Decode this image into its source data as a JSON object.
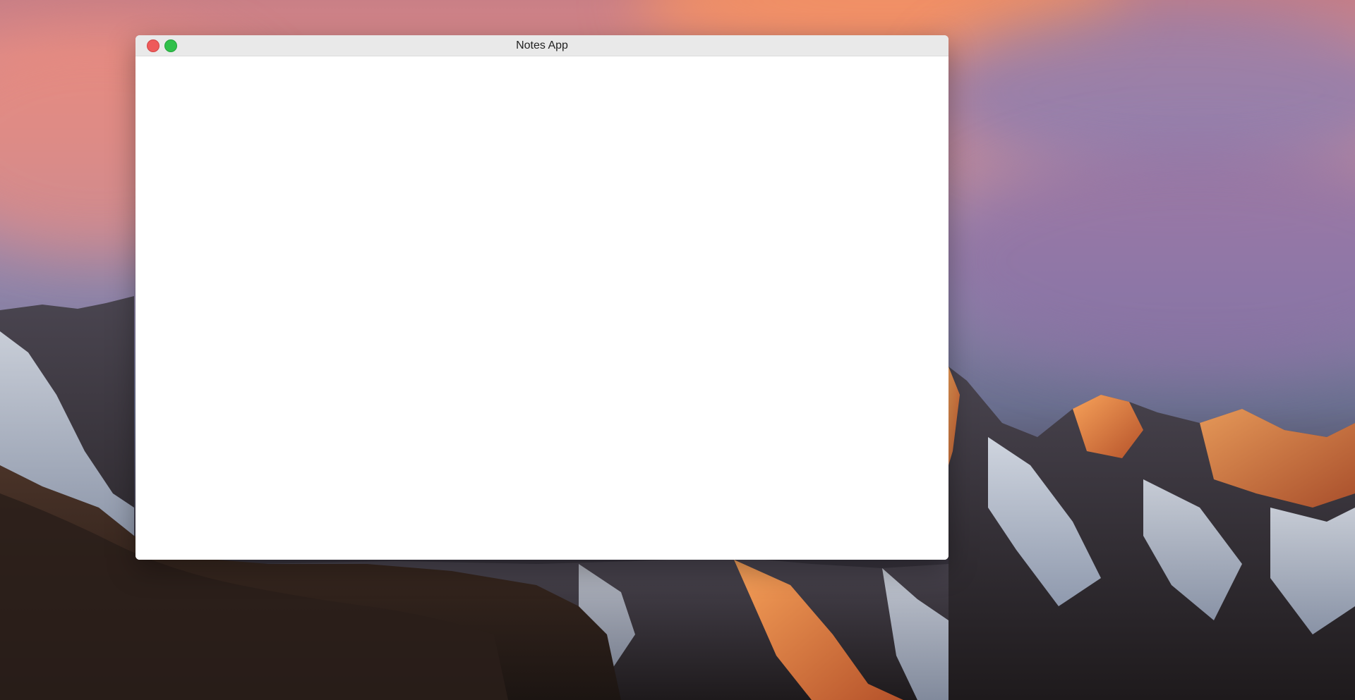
{
  "window": {
    "title": "Notes App",
    "controls": [
      {
        "name": "close",
        "color": "#ee5a5a"
      },
      {
        "name": "zoom",
        "color": "#30c04a"
      }
    ]
  },
  "desktop": {
    "wallpaper": "mountain-sunset"
  }
}
